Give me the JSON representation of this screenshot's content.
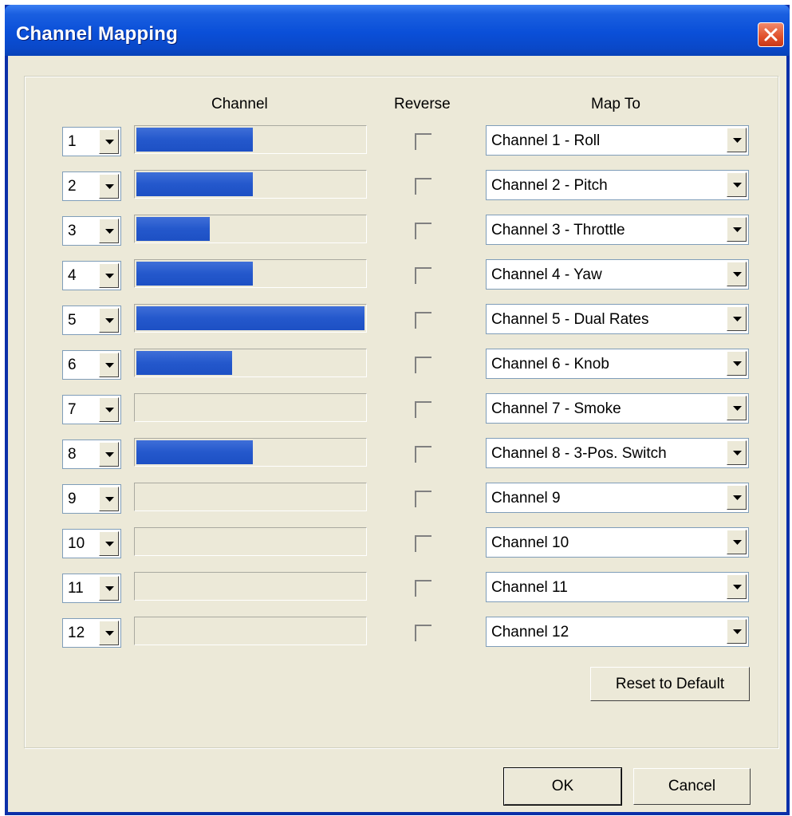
{
  "window": {
    "title": "Channel Mapping"
  },
  "headers": {
    "channel": "Channel",
    "reverse": "Reverse",
    "map_to": "Map To"
  },
  "rows": [
    {
      "channel": "1",
      "bar_fraction": 0.51,
      "map_to": "Channel 1 - Roll"
    },
    {
      "channel": "2",
      "bar_fraction": 0.51,
      "map_to": "Channel 2 - Pitch"
    },
    {
      "channel": "3",
      "bar_fraction": 0.32,
      "map_to": "Channel 3 - Throttle"
    },
    {
      "channel": "4",
      "bar_fraction": 0.51,
      "map_to": "Channel 4 - Yaw"
    },
    {
      "channel": "5",
      "bar_fraction": 1.0,
      "map_to": "Channel 5 - Dual Rates"
    },
    {
      "channel": "6",
      "bar_fraction": 0.42,
      "map_to": "Channel 6 - Knob"
    },
    {
      "channel": "7",
      "bar_fraction": 0.0,
      "map_to": "Channel 7 - Smoke"
    },
    {
      "channel": "8",
      "bar_fraction": 0.51,
      "map_to": "Channel 8 - 3-Pos. Switch"
    },
    {
      "channel": "9",
      "bar_fraction": 0.0,
      "map_to": "Channel 9"
    },
    {
      "channel": "10",
      "bar_fraction": 0.0,
      "map_to": "Channel 10"
    },
    {
      "channel": "11",
      "bar_fraction": 0.0,
      "map_to": "Channel 11"
    },
    {
      "channel": "12",
      "bar_fraction": 0.0,
      "map_to": "Channel 12"
    }
  ],
  "buttons": {
    "reset": "Reset to Default",
    "ok": "OK",
    "cancel": "Cancel"
  },
  "colors": {
    "title_bar": "#0a4fd8",
    "bar_fill": "#2458cc",
    "dialog_bg": "#ece9d8",
    "close_button": "#e0502a"
  },
  "icons": {
    "close": "close-x-icon",
    "dropdown": "chevron-down-icon"
  }
}
